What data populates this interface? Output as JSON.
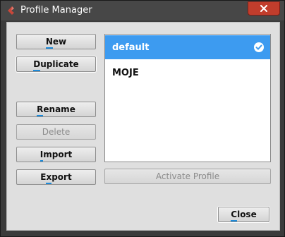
{
  "window": {
    "title": "Profile Manager"
  },
  "buttons": {
    "new": {
      "label_pre": "",
      "label_ul": "N",
      "label_post": "ew"
    },
    "duplicate": {
      "label_pre": "",
      "label_ul": "D",
      "label_post": "uplicate"
    },
    "rename": {
      "label_pre": "",
      "label_ul": "R",
      "label_post": "ename"
    },
    "delete": {
      "label": "Delete"
    },
    "import": {
      "label_pre": "",
      "label_ul": "I",
      "label_post": "mport"
    },
    "export": {
      "label_pre": "E",
      "label_ul": "x",
      "label_post": "port"
    },
    "activate": {
      "label": "Activate Profile"
    },
    "close": {
      "label_pre": "",
      "label_ul": "C",
      "label_post": "lose"
    }
  },
  "profiles": [
    {
      "name": "default",
      "selected": true,
      "active_icon": "check-circle-icon"
    },
    {
      "name": "MOJE",
      "selected": false
    }
  ],
  "colors": {
    "selection": "#3d9bf0",
    "accent_underline": "#1e8ad8",
    "close_button": "#c13d2c",
    "app_icon": "#c9473a"
  }
}
